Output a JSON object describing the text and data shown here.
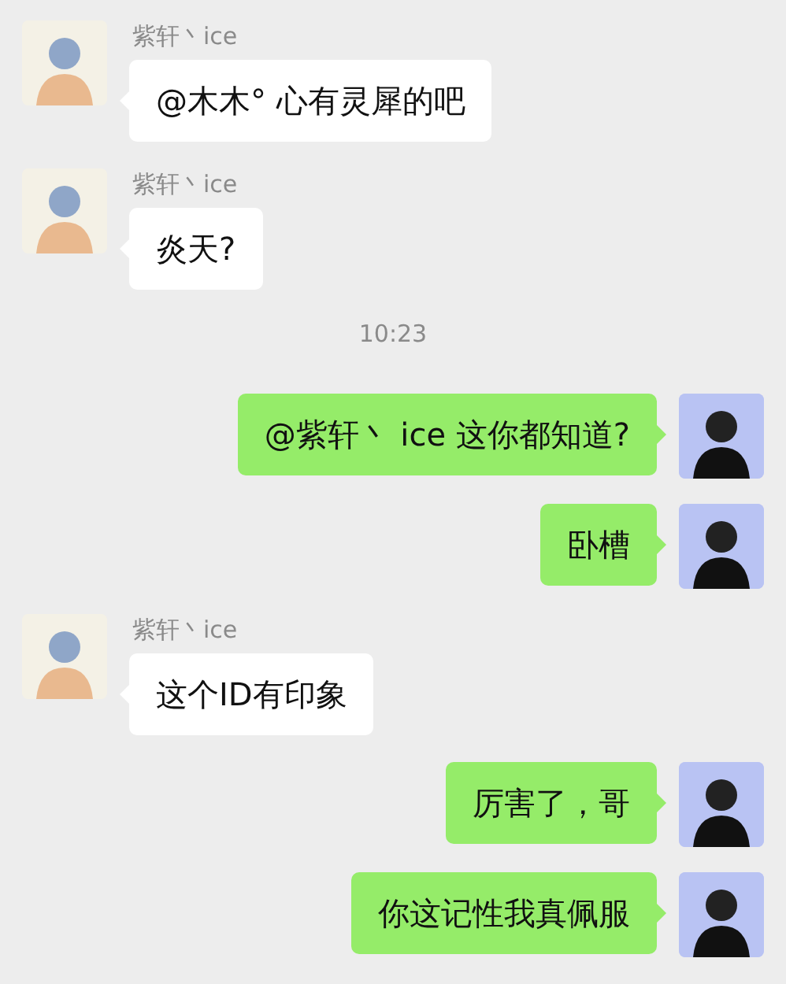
{
  "messages": [
    {
      "kind": "incoming",
      "sender": "紫轩丶ice",
      "text": "@木木° 心有灵犀的吧"
    },
    {
      "kind": "incoming",
      "sender": "紫轩丶ice",
      "text": "炎天?"
    },
    {
      "kind": "time",
      "text": "10:23"
    },
    {
      "kind": "outgoing",
      "text": "@紫轩丶 ice 这你都知道?"
    },
    {
      "kind": "outgoing",
      "text": "卧槽"
    },
    {
      "kind": "incoming",
      "sender": "紫轩丶ice",
      "text": "这个ID有印象"
    },
    {
      "kind": "outgoing",
      "text": "厉害了，哥"
    },
    {
      "kind": "outgoing",
      "text": "你这记性我真佩服"
    }
  ]
}
